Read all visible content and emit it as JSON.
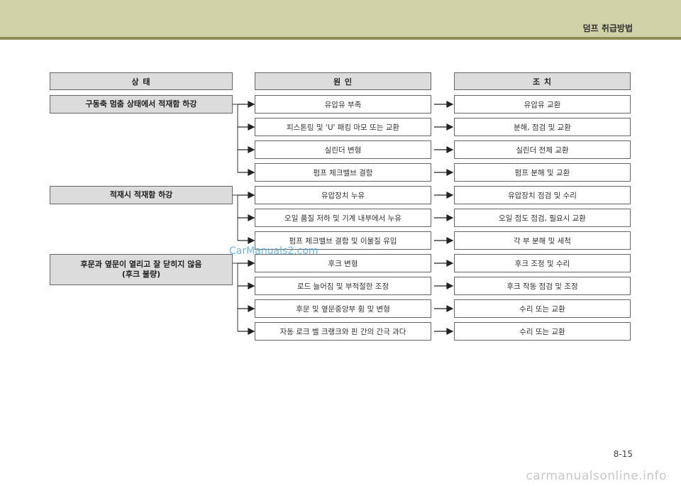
{
  "header": {
    "section_title": "덤프 취급방법"
  },
  "columns": {
    "state": "상 태",
    "cause": "원 인",
    "action": "조 치"
  },
  "states": [
    {
      "label": "구동축 멈춤 상태에서 적재함 하강"
    },
    {
      "label": "적재시 적재함 하강"
    },
    {
      "label_line1": "후문과 옆문이 열리고 잘 닫히지 않음",
      "label_line2": "(후크 불량)"
    }
  ],
  "rows": [
    {
      "cause": "유압유 부족",
      "action": "유압유 교환"
    },
    {
      "cause": "피스톤링 및 'U' 패킹 마모 또는 교환",
      "action": "분해, 점검 및 교환"
    },
    {
      "cause": "실린더 변형",
      "action": "실린더 전체 교환"
    },
    {
      "cause": "펌프 체크밸브 결함",
      "action": "펌프 분해 및 교환"
    },
    {
      "cause": "유압장치 누유",
      "action": "유압장치 점검 및 수리"
    },
    {
      "cause": "오일 품질 저하 및 기계 내부에서 누유",
      "action": "오일 점도 점검, 필요시 교환"
    },
    {
      "cause": "펌프 체크밸브 결함 및 이물질 유입",
      "action": "각 부 분해 및 세척"
    },
    {
      "cause": "후크 변형",
      "action": "후크 조정 및 수리"
    },
    {
      "cause": "로드 늘어짐 및 부적절한 조정",
      "action": "후크 작동 점검 및 조정"
    },
    {
      "cause": "후문 및 옆문중앙부 휨 및 변형",
      "action": "수리 또는 교환"
    },
    {
      "cause": "자동 로크 벨 크랭크와 핀 간의 간극 과다",
      "action": "수리 또는 교환"
    }
  ],
  "page_number": "8-15",
  "watermark": "CarManuals2.com",
  "footer_watermark": "carmanualsonline.info"
}
